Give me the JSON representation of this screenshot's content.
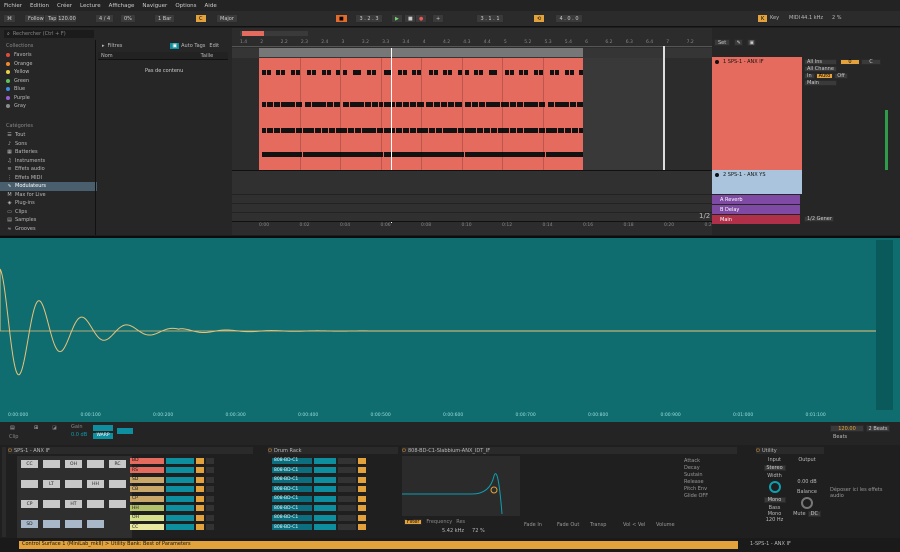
{
  "menu": [
    "Fichier",
    "Edition",
    "Créer",
    "Lecture",
    "Affichage",
    "Naviguer",
    "Options",
    "Aide"
  ],
  "toolbar": {
    "follow": "Follow",
    "tap": "Tap",
    "tempo": "120.00",
    "signature": "4 / 4",
    "swing": "0%",
    "quantize": "1 Bar",
    "key": "C",
    "scale": "Major",
    "position": "3 . 2 . 3",
    "end": "3 . 1 . 1",
    "length": "4 . 0 . 0",
    "key_label": "Key",
    "midi_label": "MIDI",
    "sample_rate": "44.1 kHz",
    "cpu": "2 %"
  },
  "browser": {
    "search_placeholder": "Rechercher (Ctrl + F)",
    "collections_title": "Collections",
    "collections": [
      {
        "name": "Favoris",
        "color": "#e24b3b"
      },
      {
        "name": "Orange",
        "color": "#f08a2d"
      },
      {
        "name": "Yellow",
        "color": "#e8d04a"
      },
      {
        "name": "Green",
        "color": "#5cc45a"
      },
      {
        "name": "Blue",
        "color": "#3d8ee6"
      },
      {
        "name": "Purple",
        "color": "#9a5fd6"
      },
      {
        "name": "Gray",
        "color": "#8c8c8c"
      }
    ],
    "categories_title": "Catégories",
    "categories": [
      "Tout",
      "Sons",
      "Batteries",
      "Instruments",
      "Effets audio",
      "Effets MIDI",
      "Modulateurs",
      "Max for Live",
      "Plug-ins",
      "Clips",
      "Samples",
      "Grooves"
    ],
    "selected_category": "Modulateurs",
    "filters_label": "Filtres",
    "auto_tags": "Auto Tags",
    "edit_label": "Edit",
    "col_name": "Nom",
    "col_size": "Taille",
    "empty": "Pas de contenu"
  },
  "arrangement": {
    "ruler": [
      "1.4",
      "2",
      "2.2",
      "2.3",
      "2.4",
      "3",
      "3.2",
      "3.3",
      "3.4",
      "4",
      "4.2",
      "4.3",
      "4.4",
      "5",
      "5.2",
      "5.3",
      "5.4",
      "6",
      "6.2",
      "6.3",
      "6.4",
      "7",
      "7.2"
    ],
    "time": [
      "0:00",
      "0:02",
      "0:04",
      "0:06",
      "0:08",
      "0:10",
      "0:12",
      "0:14",
      "0:16",
      "0:18",
      "0:20",
      "0:22"
    ],
    "set_label": "Set",
    "fraction": "1/2"
  },
  "mixer": {
    "tracks": [
      {
        "name": "1 SPS-1 - ANX IF",
        "color": "#e46b5d"
      },
      {
        "name": "2 SPS-1 - ANX YS",
        "color": "#a9c4dc"
      },
      {
        "name": "A Reverb",
        "color": "#a45bc8"
      },
      {
        "name": "B Delay",
        "color": "#a45bc8"
      },
      {
        "name": "Main",
        "color": "#c03a55"
      }
    ],
    "all_ins": "All Ins",
    "all_channels": "All Channe",
    "in_label": "In",
    "auto_label": "Auto",
    "off_label": "Off",
    "main_label": "Main",
    "cue": "1/2 Gener",
    "vol": "0",
    "pan": "C"
  },
  "wave": {
    "times": [
      "0:00:000",
      "0:00:100",
      "0:00:200",
      "0:00:300",
      "0:00:400",
      "0:00:500",
      "0:00:600",
      "0:00:700",
      "0:00:800",
      "0:00:900",
      "0:01:000",
      "0:01:100"
    ],
    "clip_name": "Clip",
    "gain_label": "Gain",
    "gain": "0.0 dB",
    "warp": "WARP",
    "bpm": "120.00",
    "beats_label": "Beats",
    "beats": "2 Beats"
  },
  "devices": {
    "track_name": "SPS-1 - ANX IF",
    "pads": [
      [
        "CC",
        "",
        "OH",
        "",
        "RC"
      ],
      [
        "",
        "LT",
        "",
        "HH",
        ""
      ],
      [
        "CP",
        "",
        "HT",
        "",
        ""
      ],
      [
        "SD",
        "",
        "",
        ""
      ]
    ],
    "pad_names": [
      "BD",
      "RS",
      "SD",
      "CB",
      "CP",
      "HH",
      "OH",
      "CC"
    ],
    "rack_title": "Drum Rack",
    "rack_items": [
      "808-BD-C1",
      "808-BD-C1",
      "808-BD-C1",
      "808-BD-C1",
      "808-BD-C1",
      "808-BD-C1",
      "808-BD-C1",
      "808-BD-C1"
    ],
    "synth_title": "808-BD-C1-Slabbium-ANX_IDT_IF",
    "filter_label": "Filter",
    "frequency": "Frequency",
    "freq_val": "5.42 kHz",
    "res_label": "Res",
    "res_val": "72 %",
    "params": [
      "Attack",
      "Decay",
      "Sustain",
      "Release",
      "Pitch Env",
      "Glide OFF",
      "Fade In",
      "Fade Out",
      "Transp",
      "Vol < Vel",
      "Volume"
    ],
    "utility_title": "Utility",
    "input": "Input",
    "stereo": "Stereo",
    "width": "Width",
    "mono": "Mono",
    "gain": "0.00 dB",
    "bass_mono": "Bass Mono",
    "bass_freq": "120 Hz",
    "output": "Output",
    "balance": "Balance",
    "mute": "Mute",
    "dc": "DC",
    "drop_hint": "Déposer ici les effets audio"
  },
  "status": {
    "text": "Control Surface 1 (MiniLab_mkII) > Utility Bank: Best of Parameters",
    "track": "1-SPS-1 - ANX IF"
  },
  "colors": {
    "clip": "#e46b5d",
    "wave": "#0f6d70",
    "waveline": "#e9c27a",
    "accent": "#f0a030"
  }
}
